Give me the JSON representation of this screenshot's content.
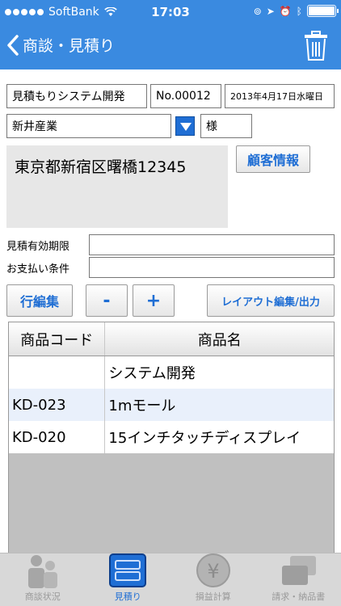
{
  "status": {
    "carrier": "SoftBank",
    "time": "17:03"
  },
  "nav": {
    "title": "商談・見積り"
  },
  "form": {
    "subject": "見積もりシステム開発",
    "number": "No.00012",
    "date": "2013年4月17日水曜日",
    "customer": "新井産業",
    "honorific": "様",
    "address": "東京都新宿区曙橋12345",
    "customer_info_button": "顧客情報",
    "validity_label": "見積有効期限",
    "validity_value": "",
    "payment_label": "お支払い条件",
    "payment_value": ""
  },
  "toolbar": {
    "row_edit": "行編集",
    "minus": "-",
    "plus": "+",
    "layout": "レイアウト編集/出力"
  },
  "table": {
    "columns": [
      "商品コード",
      "商品名"
    ],
    "rows": [
      {
        "code": "",
        "name": "システム開発"
      },
      {
        "code": "KD-023",
        "name": "1mモール"
      },
      {
        "code": "KD-020",
        "name": "15インチタッチディスプレイ"
      }
    ]
  },
  "tabs": [
    {
      "label": "商談状況",
      "icon": "people-icon"
    },
    {
      "label": "見積り",
      "icon": "estimate-icon"
    },
    {
      "label": "損益計算",
      "icon": "yen-icon"
    },
    {
      "label": "請求・納品書",
      "icon": "invoice-icon"
    }
  ],
  "colors": {
    "accent": "#3a8ae0",
    "button_text": "#1f6ed4",
    "tab_active": "#1f6ed4"
  }
}
